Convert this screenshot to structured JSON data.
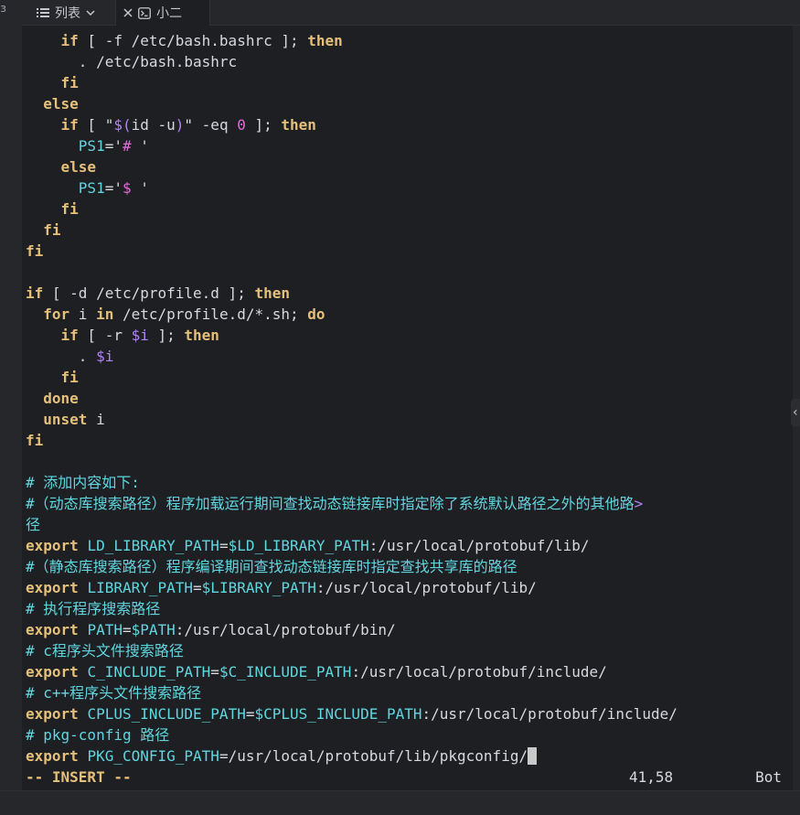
{
  "tabs": {
    "list_label": "列表",
    "session_label": "小二"
  },
  "terminal_lines": [
    [
      {
        "t": "    "
      },
      {
        "t": "if",
        "c": "k"
      },
      {
        "t": " [ -f /etc/bash.bashrc ]; "
      },
      {
        "t": "then",
        "c": "k"
      }
    ],
    [
      {
        "t": "      . /etc/bash.bashrc"
      }
    ],
    [
      {
        "t": "    "
      },
      {
        "t": "fi",
        "c": "k"
      }
    ],
    [
      {
        "t": "  "
      },
      {
        "t": "else",
        "c": "k"
      }
    ],
    [
      {
        "t": "    "
      },
      {
        "t": "if",
        "c": "k"
      },
      {
        "t": " [ \""
      },
      {
        "t": "$(",
        "c": "v"
      },
      {
        "t": "id -u"
      },
      {
        "t": ")",
        "c": "v"
      },
      {
        "t": "\" -eq "
      },
      {
        "t": "0",
        "c": "s"
      },
      {
        "t": " ]; "
      },
      {
        "t": "then",
        "c": "k"
      }
    ],
    [
      {
        "t": "      "
      },
      {
        "t": "PS1",
        "c": "c"
      },
      {
        "t": "='"
      },
      {
        "t": "# ",
        "c": "s"
      },
      {
        "t": "'"
      }
    ],
    [
      {
        "t": "    "
      },
      {
        "t": "else",
        "c": "k"
      }
    ],
    [
      {
        "t": "      "
      },
      {
        "t": "PS1",
        "c": "c"
      },
      {
        "t": "='"
      },
      {
        "t": "$ ",
        "c": "s"
      },
      {
        "t": "'"
      }
    ],
    [
      {
        "t": "    "
      },
      {
        "t": "fi",
        "c": "k"
      }
    ],
    [
      {
        "t": "  "
      },
      {
        "t": "fi",
        "c": "k"
      }
    ],
    [
      {
        "t": "fi",
        "c": "k"
      }
    ],
    [],
    [
      {
        "t": "if",
        "c": "k"
      },
      {
        "t": " [ -d /etc/profile.d ]; "
      },
      {
        "t": "then",
        "c": "k"
      }
    ],
    [
      {
        "t": "  "
      },
      {
        "t": "for",
        "c": "k"
      },
      {
        "t": " i "
      },
      {
        "t": "in",
        "c": "k"
      },
      {
        "t": " /etc/profile.d/*.sh; "
      },
      {
        "t": "do",
        "c": "k"
      }
    ],
    [
      {
        "t": "    "
      },
      {
        "t": "if",
        "c": "k"
      },
      {
        "t": " [ -r "
      },
      {
        "t": "$i",
        "c": "v"
      },
      {
        "t": " ]; "
      },
      {
        "t": "then",
        "c": "k"
      }
    ],
    [
      {
        "t": "      . "
      },
      {
        "t": "$i",
        "c": "v"
      }
    ],
    [
      {
        "t": "    "
      },
      {
        "t": "fi",
        "c": "k"
      }
    ],
    [
      {
        "t": "  "
      },
      {
        "t": "done",
        "c": "k"
      }
    ],
    [
      {
        "t": "  "
      },
      {
        "t": "unset",
        "c": "k"
      },
      {
        "t": " i"
      }
    ],
    [
      {
        "t": "fi",
        "c": "k"
      }
    ],
    [],
    [
      {
        "t": "# 添加内容如下:",
        "c": "c"
      }
    ],
    [
      {
        "t": "#（动态库搜索路径）程序加载运行期间查找动态链接库时指定除了系统默认路径之外的其他路",
        "c": "c"
      },
      {
        "t": ">",
        "c": "v"
      }
    ],
    [
      {
        "t": "径",
        "c": "c"
      }
    ],
    [
      {
        "t": "export",
        "c": "k"
      },
      {
        "t": " "
      },
      {
        "t": "LD_LIBRARY_PATH",
        "c": "c"
      },
      {
        "t": "="
      },
      {
        "t": "$LD_LIBRARY_PATH",
        "c": "c"
      },
      {
        "t": ":/usr/local/protobuf/lib/"
      }
    ],
    [
      {
        "t": "#（静态库搜索路径）程序编译期间查找动态链接库时指定查找共享库的路径",
        "c": "c"
      }
    ],
    [
      {
        "t": "export",
        "c": "k"
      },
      {
        "t": " "
      },
      {
        "t": "LIBRARY_PATH",
        "c": "c"
      },
      {
        "t": "="
      },
      {
        "t": "$LIBRARY_PATH",
        "c": "c"
      },
      {
        "t": ":/usr/local/protobuf/lib/"
      }
    ],
    [
      {
        "t": "# 执行程序搜索路径",
        "c": "c"
      }
    ],
    [
      {
        "t": "export",
        "c": "k"
      },
      {
        "t": " "
      },
      {
        "t": "PATH",
        "c": "c"
      },
      {
        "t": "="
      },
      {
        "t": "$PATH",
        "c": "c"
      },
      {
        "t": ":/usr/local/protobuf/bin/"
      }
    ],
    [
      {
        "t": "# c程序头文件搜索路径",
        "c": "c"
      }
    ],
    [
      {
        "t": "export",
        "c": "k"
      },
      {
        "t": " "
      },
      {
        "t": "C_INCLUDE_PATH",
        "c": "c"
      },
      {
        "t": "="
      },
      {
        "t": "$C_INCLUDE_PATH",
        "c": "c"
      },
      {
        "t": ":/usr/local/protobuf/include/"
      }
    ],
    [
      {
        "t": "# c++程序头文件搜索路径",
        "c": "c"
      }
    ],
    [
      {
        "t": "export",
        "c": "k"
      },
      {
        "t": " "
      },
      {
        "t": "CPLUS_INCLUDE_PATH",
        "c": "c"
      },
      {
        "t": "="
      },
      {
        "t": "$CPLUS_INCLUDE_PATH",
        "c": "c"
      },
      {
        "t": ":/usr/local/protobuf/include/"
      }
    ],
    [
      {
        "t": "# pkg-config 路径",
        "c": "c"
      }
    ],
    [
      {
        "t": "export",
        "c": "k"
      },
      {
        "t": " "
      },
      {
        "t": "PKG_CONFIG_PATH",
        "c": "c"
      },
      {
        "t": "=/usr/local/protobuf/lib/pkgconfig/"
      }
    ]
  ],
  "statusbar": {
    "mode": "-- INSERT --",
    "position": "41,58",
    "scroll": "Bot"
  },
  "colors": {
    "background": "#1e1f22",
    "keyword": "#e5c07b",
    "variable": "#5fd7e0",
    "comment": "#5fd7e0",
    "string": "#e06cd8"
  }
}
